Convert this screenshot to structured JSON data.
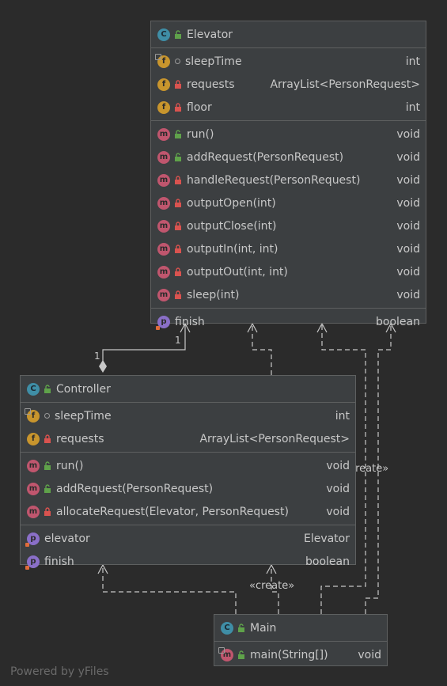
{
  "classes": {
    "elevator": {
      "name": "Elevator",
      "fields": [
        {
          "name": "sleepTime",
          "type": "int"
        },
        {
          "name": "requests",
          "type": "ArrayList<PersonRequest>"
        },
        {
          "name": "floor",
          "type": "int"
        }
      ],
      "methods": [
        {
          "name": "run()",
          "type": "void"
        },
        {
          "name": "addRequest(PersonRequest)",
          "type": "void"
        },
        {
          "name": "handleRequest(PersonRequest)",
          "type": "void"
        },
        {
          "name": "outputOpen(int)",
          "type": "void"
        },
        {
          "name": "outputClose(int)",
          "type": "void"
        },
        {
          "name": "outputIn(int, int)",
          "type": "void"
        },
        {
          "name": "outputOut(int, int)",
          "type": "void"
        },
        {
          "name": "sleep(int)",
          "type": "void"
        }
      ],
      "properties": [
        {
          "name": "finish",
          "type": "boolean"
        }
      ]
    },
    "controller": {
      "name": "Controller",
      "fields": [
        {
          "name": "sleepTime",
          "type": "int"
        },
        {
          "name": "requests",
          "type": "ArrayList<PersonRequest>"
        }
      ],
      "methods": [
        {
          "name": "run()",
          "type": "void"
        },
        {
          "name": "addRequest(PersonRequest)",
          "type": "void"
        },
        {
          "name": "allocateRequest(Elevator, PersonRequest)",
          "type": "void"
        }
      ],
      "properties": [
        {
          "name": "elevator",
          "type": "Elevator"
        },
        {
          "name": "finish",
          "type": "boolean"
        }
      ]
    },
    "main": {
      "name": "Main",
      "methods": [
        {
          "name": "main(String[])",
          "type": "void"
        }
      ]
    }
  },
  "edge_labels": {
    "create_1": "«create»",
    "create_2": "«create»",
    "mult_source": "1",
    "mult_target": "1"
  },
  "icons": {
    "class": "C",
    "field": "f",
    "method": "m",
    "property": "p"
  },
  "footer": "Powered by yFiles"
}
